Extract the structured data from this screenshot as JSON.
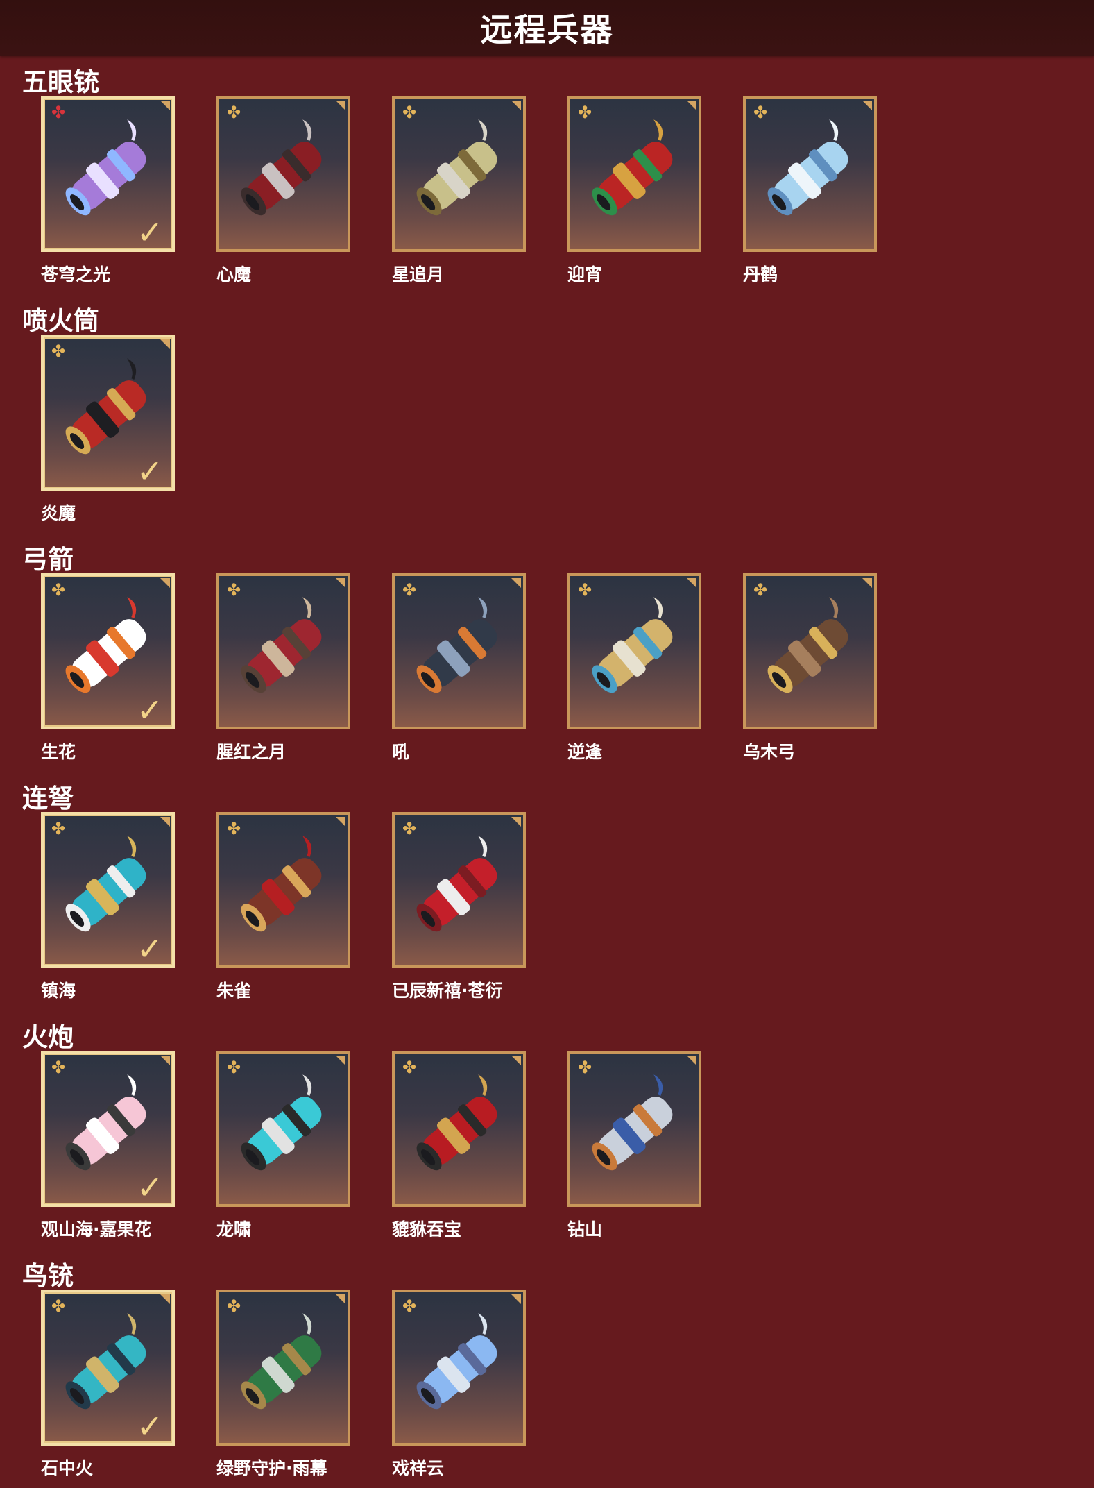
{
  "title": "远程兵器",
  "sections": [
    {
      "title": "五眼铳",
      "items": [
        {
          "name": "苍穹之光",
          "selected": true,
          "rarity_icon": "red-flower-icon",
          "art": "purple-blue gatling gun"
        },
        {
          "name": "心魔",
          "selected": false,
          "rarity_icon": "gold-flower-icon",
          "art": "dark red gatling gun"
        },
        {
          "name": "星追月",
          "selected": false,
          "rarity_icon": "gold-flower-icon",
          "art": "silver gold gatling gun"
        },
        {
          "name": "迎宵",
          "selected": false,
          "rarity_icon": "gold-flower-icon",
          "art": "red gold gatling gun"
        },
        {
          "name": "丹鹤",
          "selected": false,
          "rarity_icon": "gold-flower-icon",
          "art": "white blue gatling gun"
        }
      ]
    },
    {
      "title": "喷火筒",
      "items": [
        {
          "name": "炎魔",
          "selected": true,
          "rarity_icon": "gold-flower-icon",
          "art": "red black flamethrower"
        }
      ]
    },
    {
      "title": "弓箭",
      "items": [
        {
          "name": "生花",
          "selected": true,
          "rarity_icon": "gold-flower-icon",
          "art": "white red bow"
        },
        {
          "name": "腥红之月",
          "selected": false,
          "rarity_icon": "gold-flower-icon",
          "art": "red brown bow"
        },
        {
          "name": "吼",
          "selected": false,
          "rarity_icon": "gold-flower-icon",
          "art": "dark blue bow"
        },
        {
          "name": "逆逢",
          "selected": false,
          "rarity_icon": "gold-flower-icon",
          "art": "gold white bow"
        },
        {
          "name": "乌木弓",
          "selected": false,
          "rarity_icon": "gold-flower-icon",
          "art": "wooden bow"
        }
      ]
    },
    {
      "title": "连弩",
      "items": [
        {
          "name": "镇海",
          "selected": true,
          "rarity_icon": "gold-flower-icon",
          "art": "blue gold crossbow"
        },
        {
          "name": "朱雀",
          "selected": false,
          "rarity_icon": "gold-flower-icon",
          "art": "red brown crossbow"
        },
        {
          "name": "已辰新禧·苍衍",
          "selected": false,
          "rarity_icon": "gold-flower-icon",
          "art": "red white crossbow"
        }
      ]
    },
    {
      "title": "火炮",
      "items": [
        {
          "name": "观山海·嘉果花",
          "selected": true,
          "rarity_icon": "gold-flower-icon",
          "art": "pink flower cannon"
        },
        {
          "name": "龙啸",
          "selected": false,
          "rarity_icon": "gold-flower-icon",
          "art": "cyan dragon cannon"
        },
        {
          "name": "貔貅吞宝",
          "selected": false,
          "rarity_icon": "gold-flower-icon",
          "art": "red gold cannon"
        },
        {
          "name": "钻山",
          "selected": false,
          "rarity_icon": "gold-flower-icon",
          "art": "silver blue cannon"
        }
      ]
    },
    {
      "title": "鸟铳",
      "items": [
        {
          "name": "石中火",
          "selected": true,
          "rarity_icon": "gold-flower-icon",
          "art": "teal musket"
        },
        {
          "name": "绿野守护·雨幕",
          "selected": false,
          "rarity_icon": "gold-flower-icon",
          "art": "green musket"
        },
        {
          "name": "戏祥云",
          "selected": false,
          "rarity_icon": "gold-flower-icon",
          "art": "blue silver musket"
        }
      ]
    }
  ],
  "colors": {
    "background": "#661a1e",
    "titlebar": "#33100f",
    "card_border": "#c9975a",
    "selected_border": "#f4dfa8",
    "rarity_gold": "#e3b45a",
    "rarity_red": "#d8343c",
    "check": "#f2d389"
  }
}
